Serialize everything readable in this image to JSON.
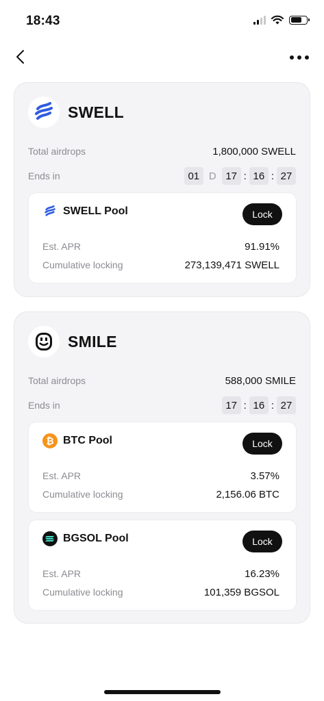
{
  "status_bar": {
    "time": "18:43"
  },
  "cards": [
    {
      "token": "SWELL",
      "logo_icon": "swell-logo-icon",
      "total_airdrops_label": "Total airdrops",
      "total_airdrops_value": "1,800,000 SWELL",
      "ends_in_label": "Ends in",
      "countdown": {
        "days": "01",
        "day_unit": "D",
        "hours": "17",
        "minutes": "16",
        "seconds": "27"
      },
      "pools": [
        {
          "name": "SWELL Pool",
          "icon": "swell-logo-icon",
          "lock_label": "Lock",
          "apr_label": "Est. APR",
          "apr_value": "91.91%",
          "cumulative_label": "Cumulative locking",
          "cumulative_value": "273,139,471 SWELL"
        }
      ]
    },
    {
      "token": "SMILE",
      "logo_icon": "smile-logo-icon",
      "total_airdrops_label": "Total airdrops",
      "total_airdrops_value": "588,000 SMILE",
      "ends_in_label": "Ends in",
      "countdown": {
        "hours": "17",
        "minutes": "16",
        "seconds": "27"
      },
      "pools": [
        {
          "name": "BTC Pool",
          "icon": "bitcoin-icon",
          "lock_label": "Lock",
          "apr_label": "Est. APR",
          "apr_value": "3.57%",
          "cumulative_label": "Cumulative locking",
          "cumulative_value": "2,156.06 BTC"
        },
        {
          "name": "BGSOL Pool",
          "icon": "bgsol-icon",
          "lock_label": "Lock",
          "apr_label": "Est. APR",
          "apr_value": "16.23%",
          "cumulative_label": "Cumulative locking",
          "cumulative_value": "101,359 BGSOL"
        }
      ]
    }
  ],
  "colors": {
    "lock_button": "#111111",
    "bitcoin": "#F7931A",
    "swell": "#2F5BE0",
    "card_bg": "#F4F4F6"
  }
}
